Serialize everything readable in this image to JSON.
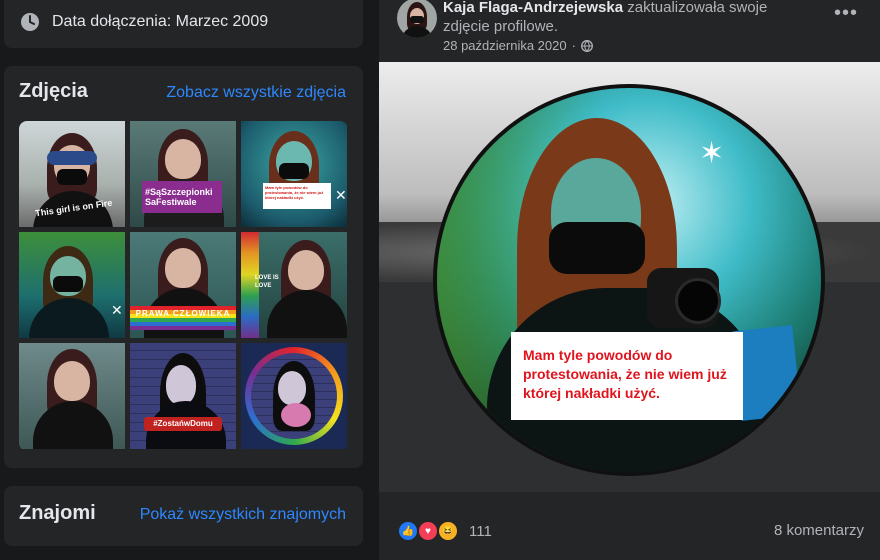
{
  "intro": {
    "joined_text": "Data dołączenia: Marzec 2009",
    "icon": "clock-icon"
  },
  "photos": {
    "title": "Zdjęcia",
    "see_all": "Zobacz wszystkie zdjęcia",
    "thumb_texts": {
      "t1": "This girl is on Fire",
      "t2": "#SąSzczepionki SaFestiwale",
      "t3": "Mam tyle powodów do protestowania, że nie wiem już której nakładki użyć.",
      "t6": "LOVE IS LOVE",
      "t5": "PRAWA CZŁOWIEKA",
      "t8": "#ZostańwDomu"
    }
  },
  "friends": {
    "title": "Znajomi",
    "see_all": "Pokaż wszystkich znajomych"
  },
  "post": {
    "author": "Kaja Flaga-Andrzejewska",
    "action": " zaktualizowała swoje zdjęcie profilowe.",
    "date": "28 października 2020",
    "date_separator": "·",
    "privacy_icon": "globe-icon",
    "more_icon": "more-icon",
    "image_caption": "Mam tyle powodów do protestowania, że nie wiem już której nakładki użyć.",
    "reaction_count": "111",
    "comments": "8 komentarzy"
  },
  "colors": {
    "page_bg": "#18191a",
    "card_bg": "#242526",
    "link": "#2d88ff",
    "caption_red": "#e0141e"
  }
}
